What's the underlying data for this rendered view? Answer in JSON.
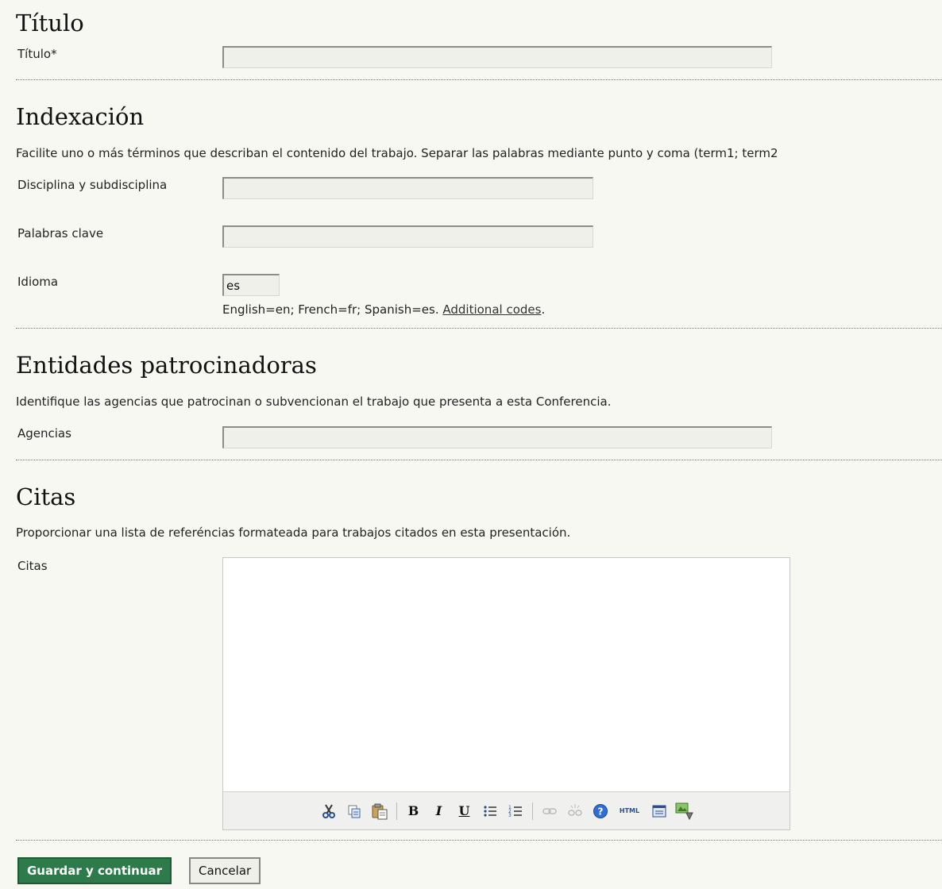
{
  "titulo": {
    "heading": "Título",
    "field_label": "Título*",
    "value": ""
  },
  "indexacion": {
    "heading": "Indexación",
    "description": "Facilite uno o más términos que describan el contenido del trabajo. Separar las palabras mediante punto y coma (term1; term2",
    "disciplina_label": "Disciplina y subdisciplina",
    "disciplina_value": "",
    "palabras_label": "Palabras clave",
    "palabras_value": "",
    "idioma_label": "Idioma",
    "idioma_value": "es",
    "idioma_hint": "English=en; French=fr; Spanish=es. ",
    "idioma_link": "Additional codes",
    "idioma_hint_end": "."
  },
  "entidades": {
    "heading": "Entidades patrocinadoras",
    "description": "Identifique las agencias que patrocinan o subvencionan el trabajo que presenta a esta Conferencia.",
    "agencias_label": "Agencias",
    "agencias_value": ""
  },
  "citas": {
    "heading": "Citas",
    "description": "Proporcionar una lista de referéncias formateada para trabajos citados en esta presentación.",
    "field_label": "Citas",
    "value": "",
    "toolbar": [
      "cut-icon",
      "copy-icon",
      "paste-icon",
      "bold-icon",
      "italic-icon",
      "underline-icon",
      "bullet-list-icon",
      "numbered-list-icon",
      "link-icon",
      "unlink-icon",
      "help-icon",
      "html-icon",
      "fullscreen-icon",
      "image-upload-icon"
    ],
    "toolbar_html_label": "HTML"
  },
  "actions": {
    "save_label": "Guardar y continuar",
    "cancel_label": "Cancelar"
  },
  "colors": {
    "background": "#f8f8f2",
    "primary_button": "#2d7a4a"
  }
}
